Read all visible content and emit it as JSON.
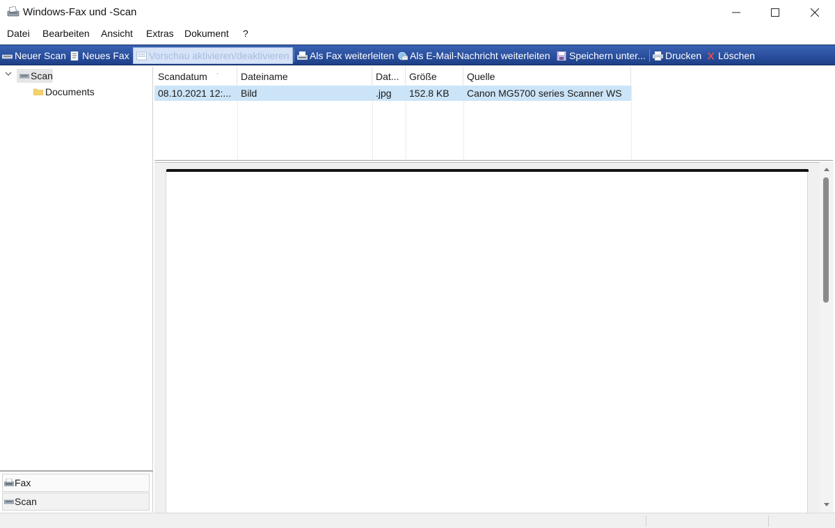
{
  "window": {
    "title": "Windows-Fax und -Scan"
  },
  "menu": [
    "Datei",
    "Bearbeiten",
    "Ansicht",
    "Extras",
    "Dokument",
    "?"
  ],
  "toolbar": {
    "new_scan": "Neuer Scan",
    "new_fax": "Neues Fax",
    "preview_toggle": "Vorschau aktivieren/deaktivieren",
    "forward_fax": "Als Fax weiterleiten",
    "forward_email": "Als E-Mail-Nachricht weiterleiten",
    "save_as": "Speichern unter...",
    "print": "Drucken",
    "delete": "Löschen"
  },
  "tree": {
    "root": "Scan",
    "child": "Documents"
  },
  "nav": {
    "fax": "Fax",
    "scan": "Scan"
  },
  "list": {
    "columns": [
      "Scandatum",
      "Dateiname",
      "Dat...",
      "Größe",
      "Quelle"
    ],
    "rows": [
      {
        "date": "08.10.2021 12:...",
        "name": "Bild",
        "type": ".jpg",
        "size": "152.8 KB",
        "source": "Canon MG5700 series Scanner WS"
      }
    ]
  },
  "colors": {
    "toolbar": "#2a4f9e",
    "selection": "#cce4f7"
  }
}
